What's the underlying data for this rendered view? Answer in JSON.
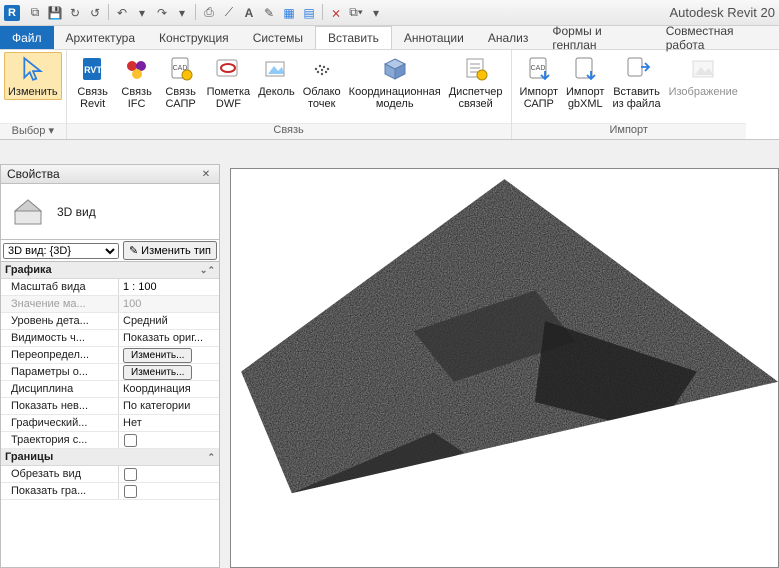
{
  "app": {
    "title": "Autodesk Revit 20",
    "logo": "R"
  },
  "qat": {
    "open": "⧉",
    "save": "💾",
    "sync": "↻",
    "sync2": "↺",
    "undo": "↶",
    "redo": "↷",
    "print": "⎙",
    "measure": "⟋",
    "text": "A",
    "mark": "✎",
    "hatch": "▦",
    "sheet": "▤",
    "close": "⨯",
    "addin": "⧉▾",
    "dropdown": "▾"
  },
  "tabs": {
    "file": "Файл",
    "items": [
      "Архитектура",
      "Конструкция",
      "Системы",
      "Вставить",
      "Аннотации",
      "Анализ",
      "Формы и генплан",
      "Совместная работа"
    ],
    "active_index": 3
  },
  "ribbon": {
    "select_panel": {
      "modify": "Изменить",
      "selector": "Выбор ▾"
    },
    "link_panel": {
      "label": "Связь",
      "rvt": "Связь\nRevit",
      "ifc": "Связь\nIFC",
      "cad": "Связь\nСАПР",
      "dwf": "Пометка\nDWF",
      "decal": "Деколь",
      "cloud": "Облако\nточек",
      "coord": "Координационная\nмодель",
      "mgr": "Диспетчер\nсвязей"
    },
    "import_panel": {
      "label": "Импорт",
      "cad": "Импорт\nСАПР",
      "gbxml": "Импорт\ngbXML",
      "fromfile": "Вставить\nиз файла",
      "image": "Изображение"
    }
  },
  "props": {
    "title": "Свойства",
    "type_label": "3D вид",
    "selector_value": "3D вид: {3D}",
    "edit_type": "Изменить тип",
    "groups": {
      "graphics": "Графика",
      "bounds": "Границы"
    },
    "rows": {
      "scale_k": "Масштаб вида",
      "scale_v": "1 : 100",
      "scaleval_k": "Значение ма...",
      "scaleval_v": "100",
      "detail_k": "Уровень дета...",
      "detail_v": "Средний",
      "vis_k": "Видимость ч...",
      "vis_v": "Показать ориг...",
      "override_k": "Переопредел...",
      "override_btn": "Изменить...",
      "params_k": "Параметры о...",
      "params_btn": "Изменить...",
      "disc_k": "Дисциплина",
      "disc_v": "Координация",
      "showhid_k": "Показать нев...",
      "showhid_v": "По категории",
      "graphst_k": "Графический...",
      "graphst_v": "Нет",
      "traj_k": "Траектория с...",
      "crop_k": "Обрезать вид",
      "showcrop_k": "Показать гра..."
    }
  }
}
